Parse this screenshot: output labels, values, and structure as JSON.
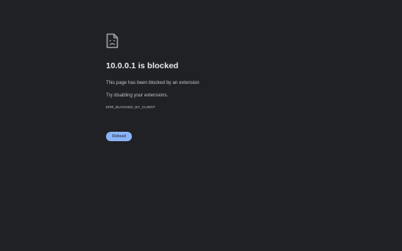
{
  "error": {
    "icon": "sad-document-icon",
    "title": "10.0.0.1 is blocked",
    "description": "This page has been blocked by an extension",
    "suggestion": "Try disabling your extensions.",
    "error_code": "ERR_BLOCKED_BY_CLIENT",
    "reload_label": "Reload"
  },
  "colors": {
    "background": "#202124",
    "title": "#e8eaed",
    "text": "#bdc1c6",
    "button": "#8ab4f8"
  }
}
